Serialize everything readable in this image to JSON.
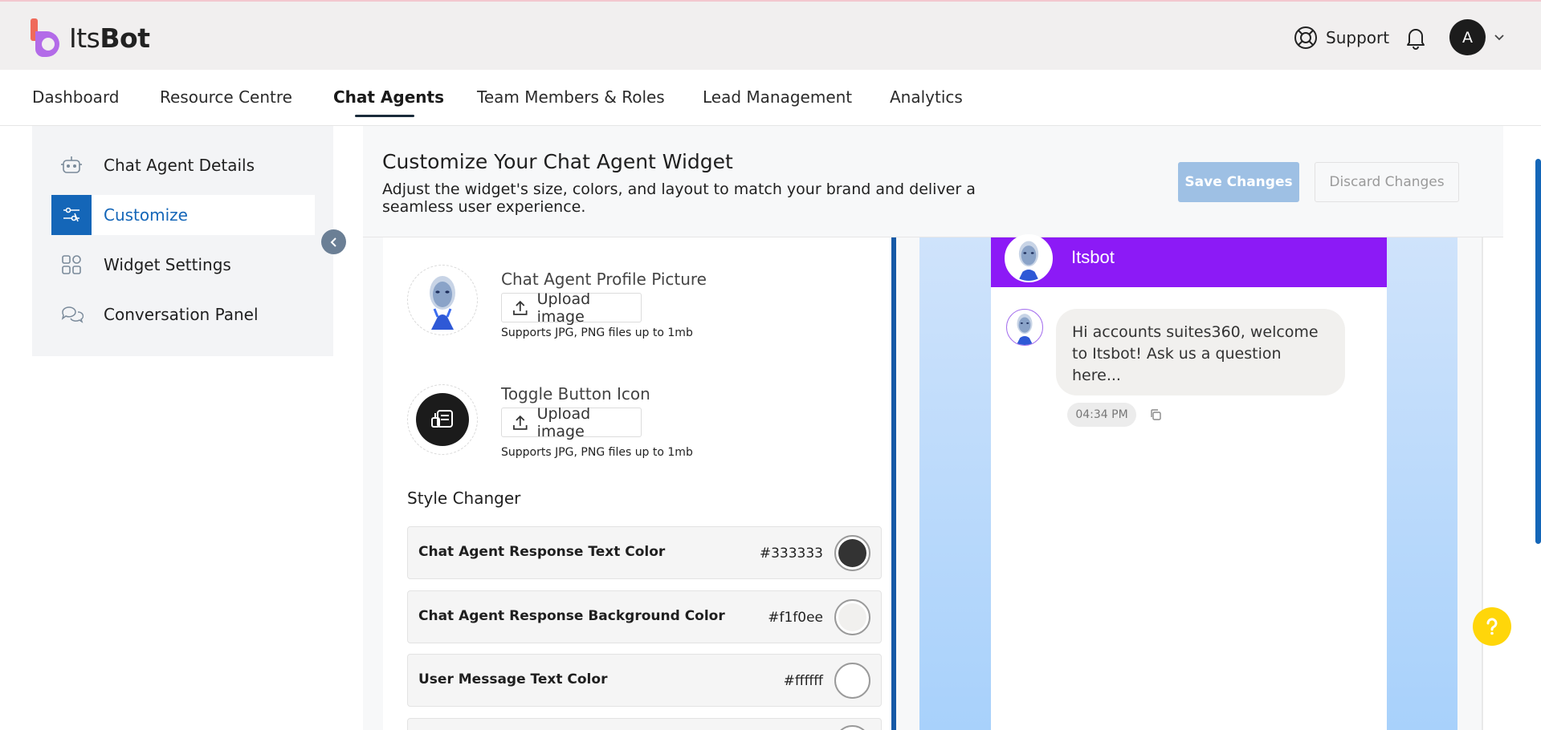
{
  "header": {
    "logo_text_light": "Its",
    "logo_text_bold": "Bot",
    "support_label": "Support",
    "avatar_initial": "A"
  },
  "nav": {
    "items": [
      {
        "label": "Dashboard",
        "active": false
      },
      {
        "label": "Resource Centre",
        "active": false
      },
      {
        "label": "Chat Agents",
        "active": true
      },
      {
        "label": "Team Members & Roles",
        "active": false
      },
      {
        "label": "Lead Management",
        "active": false
      },
      {
        "label": "Analytics",
        "active": false
      }
    ]
  },
  "sidebar": {
    "items": [
      {
        "label": "Chat Agent Details",
        "icon": "robot-icon",
        "active": false
      },
      {
        "label": "Customize",
        "icon": "customize-icon",
        "active": true
      },
      {
        "label": "Widget Settings",
        "icon": "widgets-icon",
        "active": false
      },
      {
        "label": "Conversation Panel",
        "icon": "chat-bubbles-icon",
        "active": false
      }
    ]
  },
  "main": {
    "title": "Customize Your Chat Agent Widget",
    "subtitle": "Adjust the widget's size, colors, and layout to match your brand and deliver a seamless user experience.",
    "save_label": "Save Changes",
    "discard_label": "Discard Changes"
  },
  "form": {
    "profile_picture": {
      "label": "Chat Agent Profile Picture",
      "button": "Upload image",
      "help": "Supports JPG, PNG files up to 1mb"
    },
    "toggle_icon": {
      "label": "Toggle Button Icon",
      "button": "Upload image",
      "help": "Supports JPG, PNG files up to 1mb"
    },
    "style_changer_title": "Style Changer",
    "colors": [
      {
        "label": "Chat Agent Response Text Color",
        "value": "#333333",
        "swatch": "#333333"
      },
      {
        "label": "Chat Agent Response Background Color",
        "value": "#f1f0ee",
        "swatch": "#f1f0ee"
      },
      {
        "label": "User Message Text Color",
        "value": "#ffffff",
        "swatch": "#ffffff"
      }
    ]
  },
  "preview": {
    "agent_name": "Itsbot",
    "header_color": "#8c1af6",
    "message": "Hi accounts suites360, welcome to Itsbot! Ask us a question here...",
    "time": "04:34 PM"
  },
  "colors": {
    "brand_blue": "#1466b8",
    "help_fab": "#ffd60a"
  }
}
